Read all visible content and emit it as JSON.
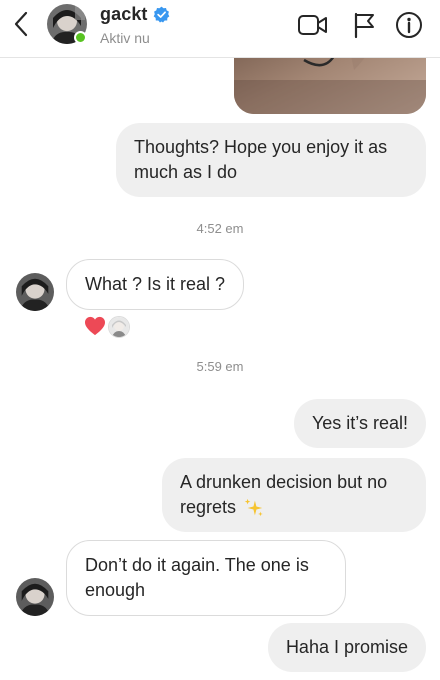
{
  "header": {
    "name": "gackt",
    "status": "Aktiv nu",
    "verified_color": "#3897f0",
    "online_color": "#58c322",
    "icons": [
      "back-chevron-icon",
      "video-camera-icon",
      "flag-icon",
      "info-icon"
    ]
  },
  "messages": [
    {
      "type": "photo",
      "sender": "me"
    },
    {
      "type": "text",
      "sender": "me",
      "text": "Thoughts? Hope you enjoy it as much as I do"
    },
    {
      "type": "timestamp",
      "text": "4:52 em"
    },
    {
      "type": "text",
      "sender": "gackt",
      "text": "What ? Is it real ?",
      "reactions": [
        "heart-reaction-icon",
        "reactor-avatar"
      ]
    },
    {
      "type": "timestamp",
      "text": "5:59 em"
    },
    {
      "type": "text",
      "sender": "me",
      "text": "Yes it’s real!"
    },
    {
      "type": "text",
      "sender": "me",
      "text": "A drunken decision but no regrets",
      "emoji": "sparkles-icon"
    },
    {
      "type": "text",
      "sender": "gackt",
      "text": "Don’t do it again. The one is enough"
    },
    {
      "type": "text",
      "sender": "me",
      "text": "Haha I promise"
    }
  ],
  "colors": {
    "outgoing_bubble": "#efefef",
    "incoming_border": "#dbdbdb",
    "heart": "#ed4956",
    "timestamp": "#8e8e8e"
  }
}
